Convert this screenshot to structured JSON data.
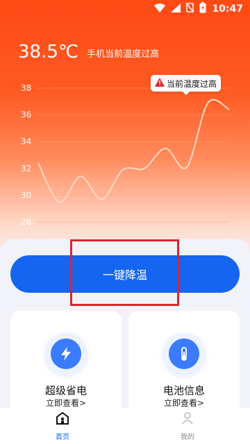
{
  "status_bar": {
    "time": "10:47",
    "icons": [
      "wifi-icon",
      "signal-icon",
      "sim-off-icon",
      "battery-charging-icon"
    ]
  },
  "header": {
    "temperature": "38.5℃",
    "warning_text": "手机当前温度过高"
  },
  "chart_data": {
    "type": "line",
    "y_ticks": [
      "38",
      "36",
      "34",
      "32",
      "30",
      "28"
    ],
    "ylim": [
      28,
      38
    ],
    "values": [
      32.4,
      29.5,
      31.4,
      29.7,
      31.9,
      32.0,
      33.5,
      32.1,
      36.9,
      36.4
    ],
    "tooltip": {
      "text": "当前温度过高",
      "icon": "warning-icon"
    },
    "colors": {
      "line": "#ffd9c4",
      "grid": "#ff9b78"
    }
  },
  "actions": {
    "cool_down_label": "一键降温"
  },
  "cards": [
    {
      "title": "超级省电",
      "link": "立即查看>",
      "icon": "lightning-icon",
      "icon_color": "#3a7bff"
    },
    {
      "title": "电池信息",
      "link": "立即查看>",
      "icon": "thermometer-icon",
      "icon_color": "#3a7bff"
    }
  ],
  "tabbar": {
    "tabs": [
      {
        "label": "首页",
        "icon": "home-icon",
        "active": true
      },
      {
        "label": "我的",
        "icon": "person-icon",
        "active": false
      }
    ]
  },
  "colors": {
    "accent": "#1565f0",
    "hero": "#ff4a14",
    "highlight": "#d8262e"
  }
}
